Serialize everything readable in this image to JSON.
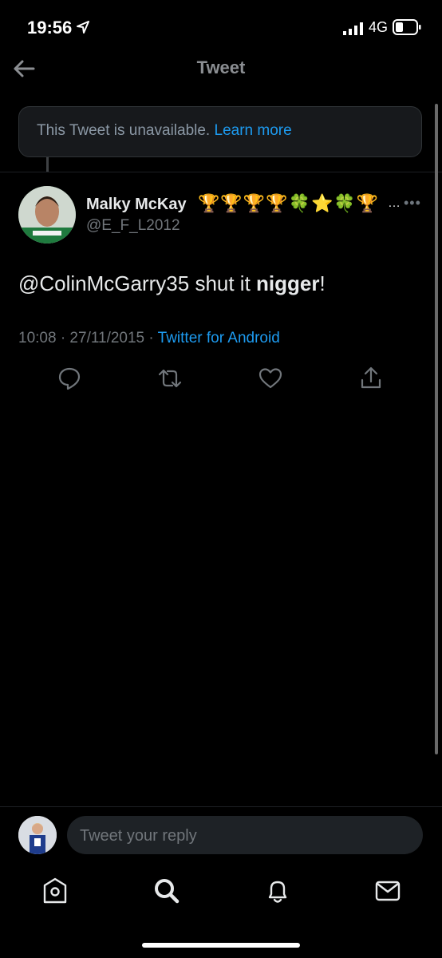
{
  "status_bar": {
    "time": "19:56",
    "network": "4G"
  },
  "nav": {
    "title": "Tweet"
  },
  "unavailable": {
    "text": "This Tweet is unavailable.",
    "link": "Learn more"
  },
  "tweet": {
    "display_name": "Malky McKay",
    "name_emojis": "🏆🏆🏆🏆🍀⭐🍀🏆",
    "name_truncation": "…",
    "handle": "@E_F_L2012",
    "text_mention": "@ColinMcGarry35 shut it ",
    "text_bold": "nigger",
    "text_end": "!",
    "time": "10:08 · 27/11/2015 · ",
    "source": "Twitter for Android",
    "more": "•••"
  },
  "reply": {
    "placeholder": "Tweet your reply"
  },
  "colors": {
    "accent": "#1d9bf0",
    "background": "#000000",
    "secondary_text": "#71767b"
  },
  "icons": {
    "actions": [
      "reply-icon",
      "retweet-icon",
      "like-icon",
      "share-icon"
    ],
    "tabs": [
      "home-icon",
      "search-icon",
      "notifications-icon",
      "messages-icon"
    ]
  }
}
